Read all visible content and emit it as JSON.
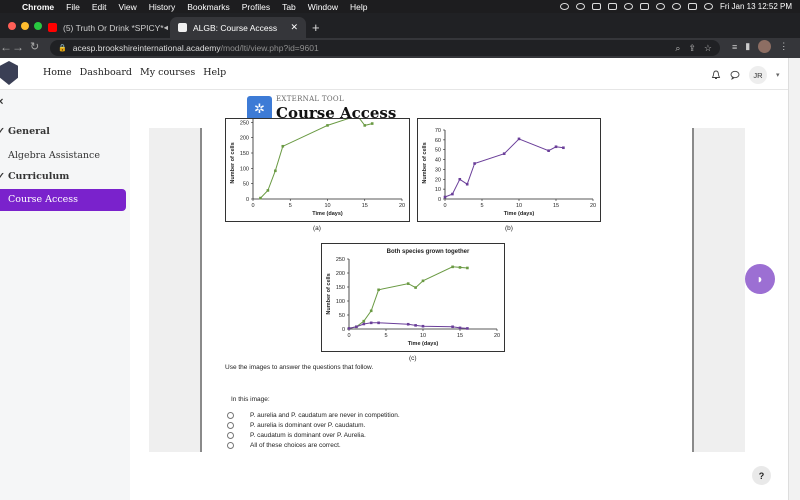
{
  "os_menu": {
    "apple": "",
    "app": "Chrome",
    "items": [
      "File",
      "Edit",
      "View",
      "History",
      "Bookmarks",
      "Profiles",
      "Tab",
      "Window",
      "Help"
    ],
    "clock": "Fri Jan 13  12:52 PM"
  },
  "browser": {
    "tabs": [
      {
        "title": "(5) Truth Or Drink *SPICY*",
        "favicon": "youtube-icon",
        "color": "#ff0000"
      },
      {
        "title": "ALGB: Course Access",
        "favicon": "moodle-icon",
        "color": "#f0f0f0"
      }
    ],
    "url_domain": "acesp.brookshireinternational.academy",
    "url_path": "/mod/lti/view.php?id=9601"
  },
  "site": {
    "nav": [
      "Home",
      "Dashboard",
      "My courses",
      "Help"
    ],
    "user_initials": "JR"
  },
  "drawer": {
    "close_glyph": "×",
    "items": [
      {
        "label": "General",
        "section": true
      },
      {
        "label": "Algebra Assistance",
        "section": false
      },
      {
        "label": "Curriculum",
        "section": true
      },
      {
        "label": "Course Access",
        "section": false,
        "active": true
      }
    ]
  },
  "page_header": {
    "kicker": "EXTERNAL TOOL",
    "title": "Course Access"
  },
  "chart_data": [
    {
      "type": "line",
      "caption": "(a)",
      "xlabel": "Time (days)",
      "ylabel": "Number of cells",
      "xlim": [
        0,
        20
      ],
      "ylim": [
        0,
        300
      ],
      "xticks": [
        0,
        5,
        10,
        15,
        20
      ],
      "yticks": [
        0,
        50,
        100,
        150,
        200,
        250,
        300
      ],
      "ytick_labels": [
        "0",
        "50",
        "100",
        "150",
        "200",
        "250",
        "300"
      ],
      "series": [
        {
          "color": "#6a9a43",
          "x": [
            1,
            2,
            3,
            4,
            10,
            14,
            15,
            16
          ],
          "y": [
            3,
            28,
            92,
            172,
            240,
            272,
            240,
            246
          ]
        }
      ]
    },
    {
      "type": "line",
      "caption": "(b)",
      "xlabel": "Time (days)",
      "ylabel": "Number of cells",
      "xlim": [
        0,
        20
      ],
      "ylim": [
        0,
        70
      ],
      "xticks": [
        0,
        5,
        10,
        15,
        20
      ],
      "yticks": [
        0,
        10,
        20,
        30,
        40,
        50,
        60,
        70
      ],
      "ytick_labels": [
        "0",
        "10",
        "20",
        "30",
        "40",
        "50",
        "60",
        "70"
      ],
      "series": [
        {
          "color": "#6a3e99",
          "x": [
            0,
            1,
            2,
            3,
            4,
            8,
            10,
            14,
            15,
            16
          ],
          "y": [
            2,
            5,
            20,
            15,
            36,
            46,
            61,
            49,
            53,
            52
          ]
        }
      ]
    },
    {
      "type": "line",
      "caption": "(c)",
      "title": "Both species grown together",
      "xlabel": "Time (days)",
      "ylabel": "Number of cells",
      "xlim": [
        0,
        20
      ],
      "ylim": [
        0,
        250
      ],
      "xticks": [
        0,
        5,
        10,
        15,
        20
      ],
      "yticks": [
        0,
        50,
        100,
        150,
        200,
        250
      ],
      "ytick_labels": [
        "0",
        "50",
        "100",
        "150",
        "200",
        "250"
      ],
      "series": [
        {
          "color": "#6a9a43",
          "x": [
            0,
            1,
            2,
            3,
            4,
            8,
            9,
            10,
            14,
            15,
            16
          ],
          "y": [
            2,
            8,
            28,
            65,
            140,
            162,
            148,
            172,
            222,
            220,
            218
          ]
        },
        {
          "color": "#6a3e99",
          "x": [
            0,
            1,
            2,
            3,
            4,
            8,
            9,
            10,
            14,
            15,
            16
          ],
          "y": [
            2,
            8,
            18,
            22,
            22,
            17,
            13,
            10,
            8,
            4,
            2
          ]
        }
      ]
    }
  ],
  "question": {
    "intro": "Use the images to answer the questions that follow.",
    "stem": "In this image:",
    "choices": [
      "P. aurelia and P. caudatum are never in competition.",
      "P. aurelia is dominant over P. caudatum.",
      "P. caudatum is dominant over P. Aurelia.",
      "All of these choices are correct."
    ]
  },
  "help_label": "?"
}
